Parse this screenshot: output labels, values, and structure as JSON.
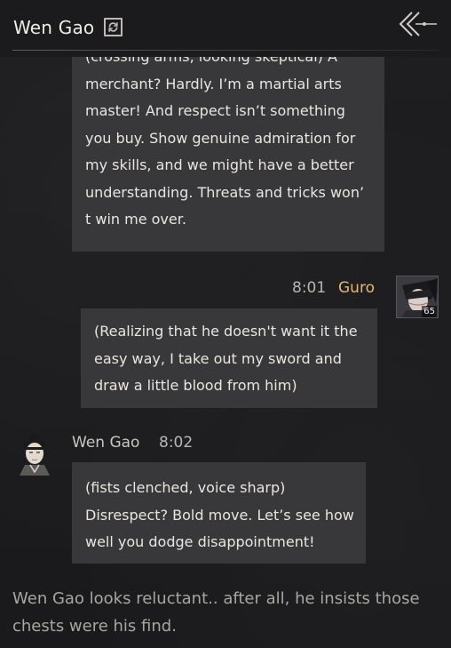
{
  "header": {
    "title": "Wen Gao"
  },
  "messages": [
    {
      "lines": [
        "(crossing arms, looking skeptical) A",
        "merchant? Hardly. I’m a martial arts",
        "master! And respect isn’t something",
        "you buy. Show genuine admiration for",
        "my skills, and we might have a better",
        "understanding. Threats and tricks won’",
        "t win me over."
      ]
    },
    {
      "time": "8:01",
      "sender": "Guro",
      "level": "65",
      "lines": [
        "(Realizing that he doesn't want it the",
        "easy way, I take out my sword and",
        "draw a little blood from him)"
      ]
    },
    {
      "sender": "Wen Gao",
      "time": "8:02",
      "lines": [
        "(fists clenched, voice sharp)",
        "Disrespect? Bold move. Let’s see how",
        "well you dodge disappointment!"
      ]
    }
  ],
  "narration": {
    "lines": [
      "Wen Gao looks reluctant.. after all, he insists those",
      "chests were his find."
    ]
  },
  "colors": {
    "background": "#1c1c1e",
    "bubble": "#38383a",
    "player_name": "#e3b774",
    "time_text": "#b9b6b1"
  },
  "icons": [
    "refresh-icon",
    "back-arrow-icon"
  ]
}
